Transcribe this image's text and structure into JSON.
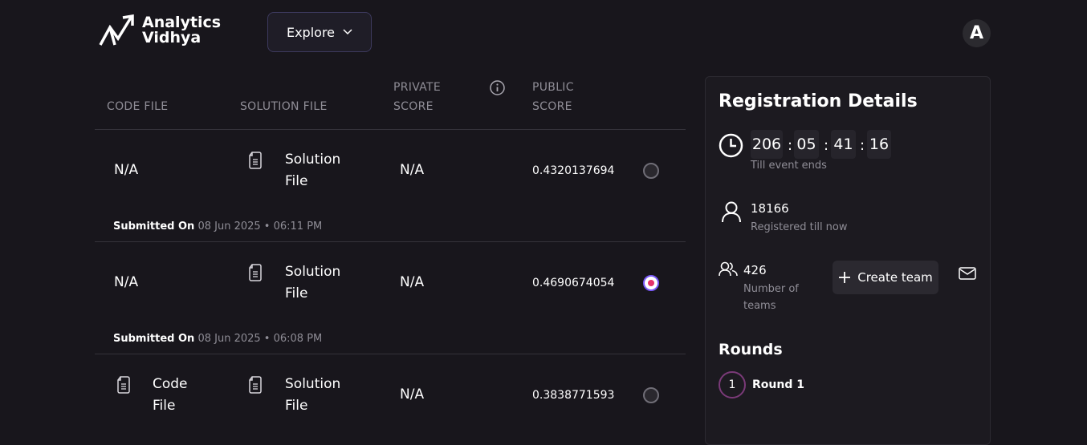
{
  "header": {
    "logo_line1": "Analytics",
    "logo_line2": "Vidhya",
    "explore_label": "Explore",
    "avatar_letter": "A"
  },
  "table": {
    "columns": {
      "code_file": "CODE FILE",
      "solution_file": "SOLUTION FILE",
      "private_score_1": "PRIVATE",
      "private_score_2": "SCORE",
      "public_score_1": "PUBLIC",
      "public_score_2": "SCORE"
    },
    "rows": [
      {
        "code_file": "N/A",
        "solution_line1": "Solution",
        "solution_line2": "File",
        "private_score": "N/A",
        "public_score": "0.4320137694",
        "selected": false,
        "submitted_label": "Submitted On",
        "submitted_date": "08 Jun 2025",
        "submitted_time": "06:11 PM"
      },
      {
        "code_file": "N/A",
        "solution_line1": "Solution",
        "solution_line2": "File",
        "private_score": "N/A",
        "public_score": "0.4690674054",
        "selected": true,
        "submitted_label": "Submitted On",
        "submitted_date": "08 Jun 2025",
        "submitted_time": "06:08 PM"
      },
      {
        "code_line1": "Code",
        "code_line2": "File",
        "solution_line1": "Solution",
        "solution_line2": "File",
        "private_score": "N/A",
        "public_score": "0.3838771593",
        "selected": false
      }
    ]
  },
  "registration": {
    "title": "Registration Details",
    "timer": {
      "days": "206",
      "hours": "05",
      "minutes": "41",
      "seconds": "16"
    },
    "timer_sub": "Till event ends",
    "registered_count": "18166",
    "registered_sub": "Registered till now",
    "teams_count": "426",
    "teams_sub_1": "Number of",
    "teams_sub_2": "teams",
    "create_team_label": "Create team",
    "rounds_title": "Rounds",
    "round_number": "1",
    "round_label": "Round 1"
  },
  "colors": {
    "background": "#18161c",
    "panel": "#1c1a20",
    "accent_purple": "#7a5af8",
    "accent_pink": "#e4326b",
    "muted_text": "#8f8d96"
  }
}
